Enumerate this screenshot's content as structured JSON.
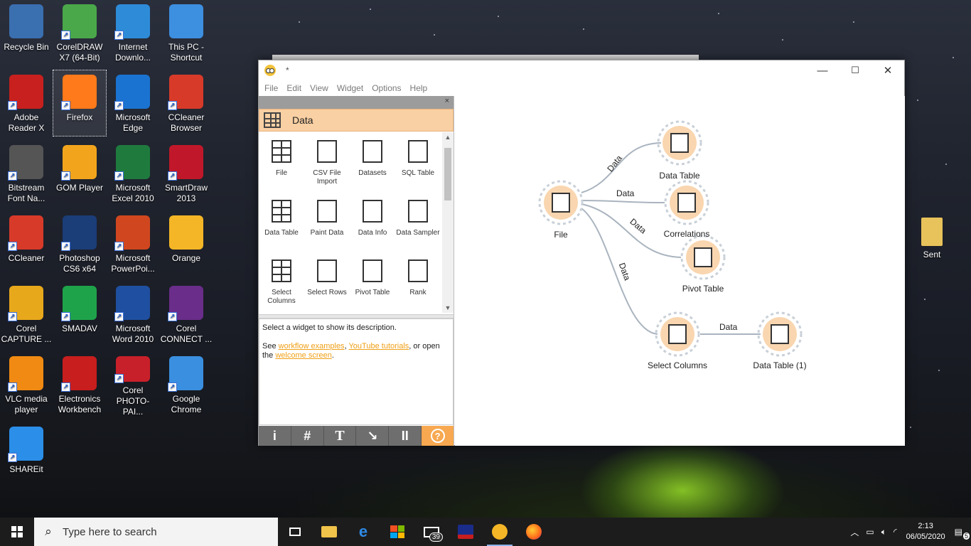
{
  "desktop": {
    "icons": [
      {
        "label": "Recycle Bin",
        "icon": "recycle-bin-icon",
        "color": "#3a6fb0"
      },
      {
        "label": "CorelDRAW X7 (64-Bit)",
        "icon": "coreldraw-icon",
        "color": "#4aa84a"
      },
      {
        "label": "Internet Downlo...",
        "icon": "internet-download-manager-icon",
        "color": "#2e8bd8"
      },
      {
        "label": "This PC - Shortcut",
        "icon": "this-pc-icon",
        "color": "#3d8fe0"
      },
      {
        "label": "Adobe Reader X",
        "icon": "adobe-reader-icon",
        "color": "#c8201e"
      },
      {
        "label": "Firefox",
        "icon": "firefox-icon",
        "color": "#ff7a1a"
      },
      {
        "label": "Microsoft Edge",
        "icon": "edge-icon",
        "color": "#1a73d0"
      },
      {
        "label": "CCleaner Browser",
        "icon": "ccleaner-browser-icon",
        "color": "#d83a2a"
      },
      {
        "label": "Bitstream Font Na...",
        "icon": "bitstream-icon",
        "color": "#555555"
      },
      {
        "label": "GOM Player",
        "icon": "gom-player-icon",
        "color": "#f2a51c"
      },
      {
        "label": "Microsoft Excel 2010",
        "icon": "excel-icon",
        "color": "#1f7a3e"
      },
      {
        "label": "SmartDraw 2013",
        "icon": "smartdraw-icon",
        "color": "#c0182a"
      },
      {
        "label": "CCleaner",
        "icon": "ccleaner-icon",
        "color": "#d83a2a"
      },
      {
        "label": "Photoshop CS6 x64",
        "icon": "photoshop-icon",
        "color": "#1b3d78"
      },
      {
        "label": "Microsoft PowerPoi...",
        "icon": "powerpoint-icon",
        "color": "#d0471f"
      },
      {
        "label": "Orange",
        "icon": "orange-icon",
        "color": "#f4b626"
      },
      {
        "label": "Corel CAPTURE ...",
        "icon": "corel-capture-icon",
        "color": "#e8a81c"
      },
      {
        "label": "SMADAV",
        "icon": "smadav-icon",
        "color": "#1fa34a"
      },
      {
        "label": "Microsoft Word 2010",
        "icon": "word-icon",
        "color": "#1f4fa0"
      },
      {
        "label": "Corel CONNECT ...",
        "icon": "corel-connect-icon",
        "color": "#6a2d8a"
      },
      {
        "label": "VLC media player",
        "icon": "vlc-icon",
        "color": "#f08a12"
      },
      {
        "label": "Electronics Workbench",
        "icon": "electronics-workbench-icon",
        "color": "#c81e1e"
      },
      {
        "label": "Corel PHOTO-PAI...",
        "icon": "corel-photopaint-icon",
        "color": "#c8202a"
      },
      {
        "label": "Google Chrome",
        "icon": "chrome-icon",
        "color": "#3a8fe0"
      },
      {
        "label": "SHAREit",
        "icon": "shareit-icon",
        "color": "#2b8ee8"
      },
      {
        "label": "Sent",
        "icon": "folder-icon",
        "color": "#e8c25a"
      }
    ]
  },
  "window": {
    "title": "*",
    "controls": {
      "minimize": "—",
      "maximize": "☐",
      "close": "✕"
    },
    "menu": [
      "File",
      "Edit",
      "View",
      "Widget",
      "Options",
      "Help"
    ]
  },
  "dock": {
    "close": "×",
    "category": "Data",
    "widgets": [
      {
        "label": "File",
        "icon": "file-icon"
      },
      {
        "label": "CSV File Import",
        "icon": "csv-icon"
      },
      {
        "label": "Datasets",
        "icon": "datasets-icon"
      },
      {
        "label": "SQL Table",
        "icon": "sql-table-icon"
      },
      {
        "label": "Data Table",
        "icon": "data-table-icon"
      },
      {
        "label": "Paint Data",
        "icon": "paint-data-icon"
      },
      {
        "label": "Data Info",
        "icon": "data-info-icon"
      },
      {
        "label": "Data Sampler",
        "icon": "data-sampler-icon"
      },
      {
        "label": "Select Columns",
        "icon": "select-columns-icon"
      },
      {
        "label": "Select Rows",
        "icon": "select-rows-icon"
      },
      {
        "label": "Pivot Table",
        "icon": "pivot-table-icon"
      },
      {
        "label": "Rank",
        "icon": "rank-icon"
      }
    ],
    "description": {
      "line1": "Select a widget to show its description.",
      "see": "See ",
      "link1": "workflow examples",
      "comma": ", ",
      "link2": "YouTube tutorials",
      "or_open": ", or open the ",
      "link3": "welcome screen",
      "end": "."
    },
    "tools": [
      "i",
      "#",
      "T",
      "↘",
      "II",
      "?"
    ]
  },
  "canvas": {
    "nodes": [
      {
        "id": "file",
        "label": "File"
      },
      {
        "id": "data_table",
        "label": "Data Table"
      },
      {
        "id": "correlations",
        "label": "Correlations"
      },
      {
        "id": "pivot_table",
        "label": "Pivot Table"
      },
      {
        "id": "select_columns",
        "label": "Select Columns"
      },
      {
        "id": "data_table_1",
        "label": "Data Table (1)"
      }
    ],
    "edge_label": "Data",
    "node_color": "#f9d6b0",
    "link_color": "#aab4bf"
  },
  "taskbar": {
    "search_placeholder": "Type here to search",
    "mail_badge": "39",
    "time": "2:13",
    "date": "06/05/2020",
    "notification_count": "5"
  }
}
